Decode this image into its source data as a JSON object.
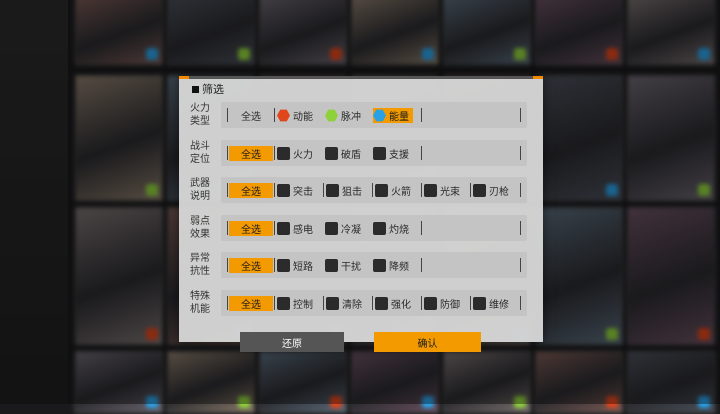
{
  "dialog": {
    "title": "筛选",
    "reset_label": "还原",
    "confirm_label": "确认"
  },
  "rows": [
    {
      "label": "火力类型",
      "all": "全选",
      "all_selected": false,
      "options": [
        {
          "label": "动能",
          "icon": "kinetic-hexagon-icon",
          "color": "#e0451c",
          "selected": false
        },
        {
          "label": "脉冲",
          "icon": "pulse-hexagon-icon",
          "color": "#8fd13a",
          "selected": false
        },
        {
          "label": "能量",
          "icon": "energy-hexagon-icon",
          "color": "#2aa0e6",
          "selected": true
        }
      ]
    },
    {
      "label": "战斗定位",
      "all": "全选",
      "all_selected": true,
      "options": [
        {
          "label": "火力",
          "icon": "firepower-role-icon",
          "selected": false
        },
        {
          "label": "破盾",
          "icon": "shieldbreak-role-icon",
          "selected": false
        },
        {
          "label": "支援",
          "icon": "support-role-icon",
          "selected": false
        }
      ]
    },
    {
      "label": "武器说明",
      "all": "全选",
      "all_selected": true,
      "options": [
        {
          "label": "突击",
          "icon": "assault-weapon-icon",
          "selected": false
        },
        {
          "label": "狙击",
          "icon": "sniper-weapon-icon",
          "selected": false
        },
        {
          "label": "火箭",
          "icon": "rocket-weapon-icon",
          "selected": false
        },
        {
          "label": "光束",
          "icon": "beam-weapon-icon",
          "selected": false
        },
        {
          "label": "刃枪",
          "icon": "bladegun-weapon-icon",
          "selected": false
        }
      ]
    },
    {
      "label": "弱点效果",
      "all": "全选",
      "all_selected": true,
      "options": [
        {
          "label": "感电",
          "icon": "shock-effect-icon",
          "selected": false
        },
        {
          "label": "冷凝",
          "icon": "frost-effect-icon",
          "selected": false
        },
        {
          "label": "灼烧",
          "icon": "burn-effect-icon",
          "selected": false
        }
      ]
    },
    {
      "label": "异常抗性",
      "all": "全选",
      "all_selected": true,
      "options": [
        {
          "label": "短路",
          "icon": "shortcircuit-resist-icon",
          "selected": false
        },
        {
          "label": "干扰",
          "icon": "jamming-resist-icon",
          "selected": false
        },
        {
          "label": "降频",
          "icon": "downclock-resist-icon",
          "selected": false
        }
      ]
    },
    {
      "label": "特殊机能",
      "all": "全选",
      "all_selected": true,
      "options": [
        {
          "label": "控制",
          "icon": "control-function-icon",
          "selected": false
        },
        {
          "label": "清除",
          "icon": "cleanse-function-icon",
          "selected": false
        },
        {
          "label": "强化",
          "icon": "buff-function-icon",
          "selected": false
        },
        {
          "label": "防御",
          "icon": "defense-function-icon",
          "selected": false
        },
        {
          "label": "维修",
          "icon": "repair-function-icon",
          "selected": false
        }
      ]
    }
  ],
  "colors": {
    "accent": "#f39a00",
    "panel": "#d6d6d6",
    "bar": "#c4c4c4"
  }
}
